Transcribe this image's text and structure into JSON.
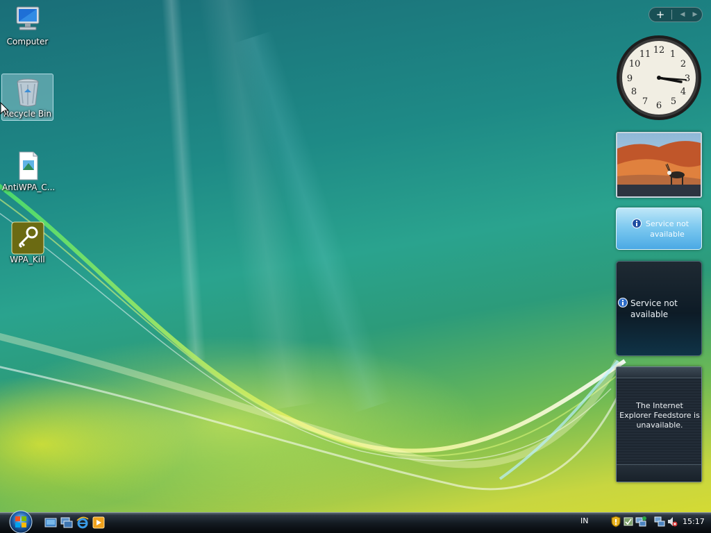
{
  "desktop": {
    "icons": [
      {
        "label": "Computer",
        "icon": "computer-icon"
      },
      {
        "label": "Recycle Bin",
        "icon": "recycle-bin-icon",
        "selected": true
      },
      {
        "label": "AntiWPA_C...",
        "icon": "file-icon"
      },
      {
        "label": "WPA_Kill",
        "icon": "key-icon"
      }
    ]
  },
  "sidebar": {
    "controls": {
      "add": "+",
      "prev": "◀",
      "next": "▶"
    },
    "clock": {
      "numerals": [
        "12",
        "1",
        "2",
        "3",
        "4",
        "5",
        "6",
        "7",
        "8",
        "9",
        "10",
        "11"
      ],
      "time": "15:17"
    },
    "slideshow": {
      "subject": "oryx-in-desert"
    },
    "weather_gadget": {
      "message": "Service not available"
    },
    "stocks_gadget": {
      "message": "Service not available"
    },
    "feed_gadget": {
      "message": "The Internet Explorer Feedstore is unavailable."
    }
  },
  "taskbar": {
    "quick_launch": [
      "show-desktop-icon",
      "switch-windows-icon",
      "internet-explorer-icon",
      "media-player-icon"
    ],
    "language": "IN",
    "tray_icons": [
      "security-shield-icon",
      "update-icon",
      "network-status-icon",
      "network-icon",
      "volume-muted-icon"
    ],
    "clock": "15:17"
  },
  "colors": {
    "accent": "#1e8a86",
    "taskbar": "#141b22"
  }
}
